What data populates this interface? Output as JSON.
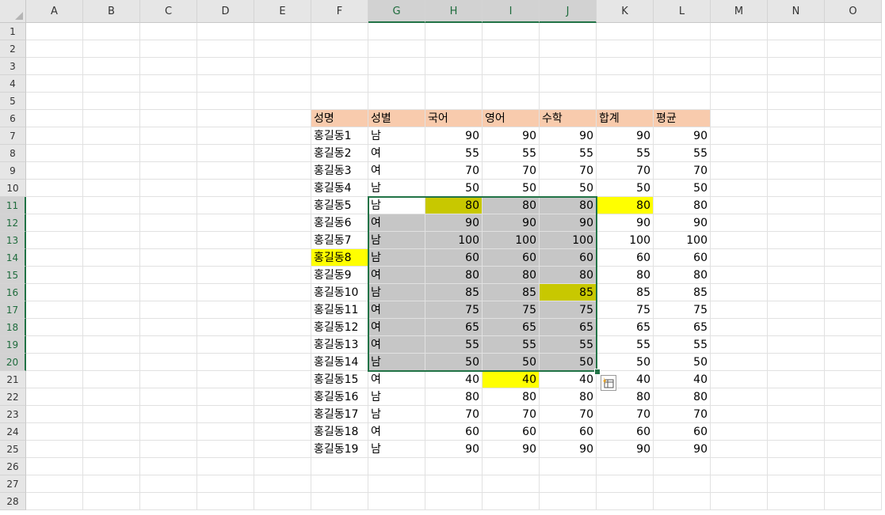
{
  "columns": [
    "A",
    "B",
    "C",
    "D",
    "E",
    "F",
    "G",
    "H",
    "I",
    "J",
    "K",
    "L",
    "M",
    "N",
    "O"
  ],
  "selected_columns": [
    "G",
    "H",
    "I",
    "J"
  ],
  "rows": [
    "1",
    "2",
    "3",
    "4",
    "5",
    "6",
    "7",
    "8",
    "9",
    "10",
    "11",
    "12",
    "13",
    "14",
    "15",
    "16",
    "17",
    "18",
    "19",
    "20",
    "21",
    "22",
    "23",
    "24",
    "25",
    "26",
    "27",
    "28"
  ],
  "selected_rows": [
    "11",
    "12",
    "13",
    "14",
    "15",
    "16",
    "17",
    "18",
    "19",
    "20"
  ],
  "colors": {
    "header_fill": "#f8cbad",
    "selection_gray": "#c6c6c6",
    "olive": "#c8c800",
    "yellow": "#ffff00",
    "white": "#ffffff",
    "accent": "#217346"
  },
  "table": {
    "headers": [
      "성명",
      "성별",
      "국어",
      "영어",
      "수학",
      "합계",
      "평균"
    ],
    "rows": [
      [
        "홍길동1",
        "남",
        "90",
        "90",
        "90",
        "90",
        "90"
      ],
      [
        "홍길동2",
        "여",
        "55",
        "55",
        "55",
        "55",
        "55"
      ],
      [
        "홍길동3",
        "여",
        "70",
        "70",
        "70",
        "70",
        "70"
      ],
      [
        "홍길동4",
        "남",
        "50",
        "50",
        "50",
        "50",
        "50"
      ],
      [
        "홍길동5",
        "남",
        "80",
        "80",
        "80",
        "80",
        "80"
      ],
      [
        "홍길동6",
        "여",
        "90",
        "90",
        "90",
        "90",
        "90"
      ],
      [
        "홍길동7",
        "남",
        "100",
        "100",
        "100",
        "100",
        "100"
      ],
      [
        "홍길동8",
        "남",
        "60",
        "60",
        "60",
        "60",
        "60"
      ],
      [
        "홍길동9",
        "여",
        "80",
        "80",
        "80",
        "80",
        "80"
      ],
      [
        "홍길동10",
        "남",
        "85",
        "85",
        "85",
        "85",
        "85"
      ],
      [
        "홍길동11",
        "여",
        "75",
        "75",
        "75",
        "75",
        "75"
      ],
      [
        "홍길동12",
        "여",
        "65",
        "65",
        "65",
        "65",
        "65"
      ],
      [
        "홍길동13",
        "여",
        "55",
        "55",
        "55",
        "55",
        "55"
      ],
      [
        "홍길동14",
        "남",
        "50",
        "50",
        "50",
        "50",
        "50"
      ],
      [
        "홍길동15",
        "여",
        "40",
        "40",
        "40",
        "40",
        "40"
      ],
      [
        "홍길동16",
        "남",
        "80",
        "80",
        "80",
        "80",
        "80"
      ],
      [
        "홍길동17",
        "남",
        "70",
        "70",
        "70",
        "70",
        "70"
      ],
      [
        "홍길동18",
        "여",
        "60",
        "60",
        "60",
        "60",
        "60"
      ],
      [
        "홍길동19",
        "남",
        "90",
        "90",
        "90",
        "90",
        "90"
      ]
    ]
  },
  "quick_analysis_icon": "quick-analysis-icon"
}
